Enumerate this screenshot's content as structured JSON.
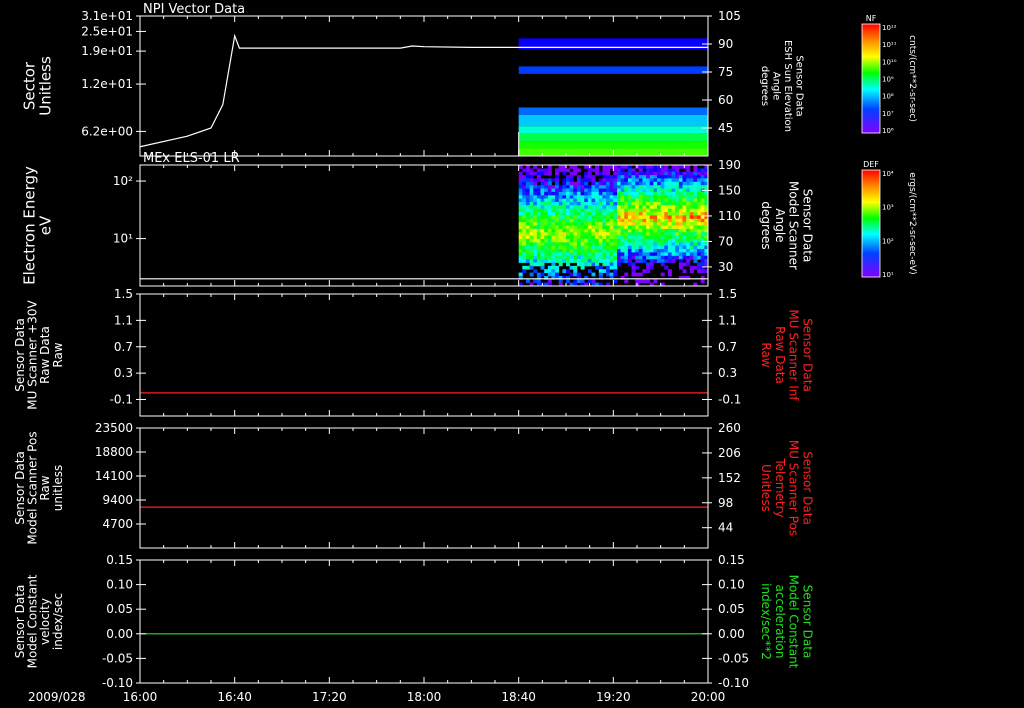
{
  "date_label": "2009/028",
  "time_ticks": [
    "16:00",
    "16:40",
    "17:20",
    "18:00",
    "18:40",
    "19:20",
    "20:00"
  ],
  "colors": {
    "axis": "#ffffff",
    "red": "#ff2020",
    "green": "#20e020"
  },
  "chart_data": [
    {
      "type": "line+spectrogram",
      "title": "NPI Vector Data",
      "left_axis": {
        "label": [
          "Sector",
          "Unitless"
        ],
        "log": true,
        "ylim": [
          4.4,
          31
        ],
        "ticks": [
          {
            "v": 31,
            "t": "3.1e+01"
          },
          {
            "v": 25,
            "t": "2.5e+01"
          },
          {
            "v": 19,
            "t": "1.9e+01"
          },
          {
            "v": 12,
            "t": "1.2e+01"
          },
          {
            "v": 6.2,
            "t": "6.2e+00"
          }
        ]
      },
      "right_axis": {
        "label": [
          "Sensor Data",
          "ESH Sun Elevation",
          "Angle",
          "degrees"
        ],
        "ylim": [
          30,
          105
        ],
        "ticks": [
          {
            "v": 105,
            "t": "105"
          },
          {
            "v": 90,
            "t": "90"
          },
          {
            "v": 75,
            "t": "75"
          },
          {
            "v": 60,
            "t": "60"
          },
          {
            "v": 45,
            "t": "45"
          }
        ]
      },
      "line": {
        "x": [
          "16:00",
          "16:20",
          "16:30",
          "16:35",
          "16:40",
          "16:42",
          "17:30",
          "17:50",
          "17:55",
          "18:00",
          "18:20",
          "18:40",
          "20:00"
        ],
        "y": [
          5.0,
          5.8,
          6.5,
          9.0,
          23.5,
          19.8,
          19.8,
          19.8,
          20.4,
          20.2,
          20.0,
          20.0,
          20.0
        ]
      },
      "spectrogram": {
        "x_start": "18:40",
        "x_end": "20:00",
        "bands": [
          {
            "y0": 87,
            "y1": 93,
            "level": 0.12
          },
          {
            "y0": 74,
            "y1": 78,
            "level": 0.18
          },
          {
            "y0": 52,
            "y1": 56,
            "level": 0.22
          },
          {
            "y0": 46,
            "y1": 52,
            "level": 0.3
          },
          {
            "y0": 42,
            "y1": 46,
            "level": 0.38
          },
          {
            "y0": 38,
            "y1": 42,
            "level": 0.5
          },
          {
            "y0": 34,
            "y1": 38,
            "level": 0.58
          },
          {
            "y0": 30,
            "y1": 34,
            "level": 0.62
          }
        ]
      },
      "colorbar": {
        "label": "NF",
        "unit": "cnts/(cm**2-sr-sec)",
        "ticks": [
          "10¹²",
          "10¹¹",
          "10¹⁰",
          "10⁹",
          "10⁸",
          "10⁷",
          "10⁶"
        ]
      }
    },
    {
      "type": "spectrogram",
      "title": "MEx ELS-01 LR",
      "left_axis": {
        "label": [
          "Electron Energy",
          "eV"
        ],
        "log": true,
        "ylim": [
          1.5,
          190
        ],
        "ticks": [
          {
            "v": 100,
            "t": "10²"
          },
          {
            "v": 10,
            "t": "10¹"
          }
        ]
      },
      "right_axis": {
        "label": [
          "Sensor Data",
          "Model Scanner",
          "Angle",
          "degrees"
        ],
        "ylim": [
          0,
          190
        ],
        "ticks": [
          {
            "v": 190,
            "t": "190"
          },
          {
            "v": 150,
            "t": "150"
          },
          {
            "v": 110,
            "t": "110"
          },
          {
            "v": 70,
            "t": "70"
          },
          {
            "v": 30,
            "t": "30"
          }
        ]
      },
      "line": {
        "x": [
          "16:00",
          "20:00"
        ],
        "y": [
          2.0,
          2.0
        ]
      },
      "spectrogram": {
        "x_start": "18:40",
        "x_end": "20:00",
        "change": "19:20"
      },
      "colorbar": {
        "label": "DEF",
        "unit": "ergs/(cm**2-sr-sec-eV)",
        "ticks": [
          "10⁴",
          "10³",
          "10²",
          "10¹"
        ]
      }
    },
    {
      "type": "line",
      "left_axis": {
        "label": [
          "Sensor Data",
          "MU Scanner +30V",
          "Raw Data",
          "Raw"
        ],
        "ylim": [
          -0.35,
          1.5
        ],
        "ticks": [
          {
            "v": 1.5,
            "t": "1.5"
          },
          {
            "v": 1.1,
            "t": "1.1"
          },
          {
            "v": 0.7,
            "t": "0.7"
          },
          {
            "v": 0.3,
            "t": "0.3"
          },
          {
            "v": -0.1,
            "t": "-0.1"
          }
        ]
      },
      "right_axis": {
        "label": [
          "Sensor Data",
          "MU Scanner Inf",
          "Raw Data",
          "Raw"
        ],
        "color": "red",
        "ylim": [
          -0.35,
          1.5
        ],
        "ticks": [
          {
            "v": 1.5,
            "t": "1.5"
          },
          {
            "v": 1.1,
            "t": "1.1"
          },
          {
            "v": 0.7,
            "t": "0.7"
          },
          {
            "v": 0.3,
            "t": "0.3"
          },
          {
            "v": -0.1,
            "t": "-0.1"
          }
        ]
      },
      "series": [
        {
          "color": "red",
          "x": [
            "16:00",
            "20:00"
          ],
          "y": [
            0.0,
            0.0
          ]
        }
      ]
    },
    {
      "type": "line",
      "left_axis": {
        "label": [
          "Sensor Data",
          "Model Scanner Pos",
          "Raw",
          "unitless"
        ],
        "ylim": [
          0,
          23500
        ],
        "ticks": [
          {
            "v": 23500,
            "t": "23500"
          },
          {
            "v": 18800,
            "t": "18800"
          },
          {
            "v": 14100,
            "t": "14100"
          },
          {
            "v": 9400,
            "t": "9400"
          },
          {
            "v": 4700,
            "t": "4700"
          }
        ]
      },
      "right_axis": {
        "label": [
          "Sensor Data",
          "MU Scanner Pos",
          "Telemetry",
          "Unitless"
        ],
        "color": "red",
        "ylim": [
          0,
          260
        ],
        "ticks": [
          {
            "v": 260,
            "t": "260"
          },
          {
            "v": 206,
            "t": "206"
          },
          {
            "v": 152,
            "t": "152"
          },
          {
            "v": 98,
            "t": "98"
          },
          {
            "v": 44,
            "t": "44"
          }
        ]
      },
      "series": [
        {
          "color": "red",
          "x": [
            "16:00",
            "20:00"
          ],
          "y": [
            8000,
            8000
          ]
        }
      ]
    },
    {
      "type": "line",
      "left_axis": {
        "label": [
          "Sensor Data",
          "Model Constant",
          "velocity",
          "index/sec"
        ],
        "ylim": [
          -0.1,
          0.15
        ],
        "ticks": [
          {
            "v": 0.15,
            "t": "0.15"
          },
          {
            "v": 0.1,
            "t": "0.10"
          },
          {
            "v": 0.05,
            "t": "0.05"
          },
          {
            "v": 0,
            "t": "0.00"
          },
          {
            "v": -0.05,
            "t": "-0.05"
          },
          {
            "v": -0.1,
            "t": "-0.10"
          }
        ]
      },
      "right_axis": {
        "label": [
          "Sensor Data",
          "Model Constant",
          "acceleration",
          "index/sec**2"
        ],
        "color": "green",
        "ylim": [
          -0.1,
          0.15
        ],
        "ticks": [
          {
            "v": 0.15,
            "t": "0.15"
          },
          {
            "v": 0.1,
            "t": "0.10"
          },
          {
            "v": 0.05,
            "t": "0.05"
          },
          {
            "v": 0,
            "t": "0.00"
          },
          {
            "v": -0.05,
            "t": "-0.05"
          },
          {
            "v": -0.1,
            "t": "-0.10"
          }
        ]
      },
      "series": [
        {
          "color": "green",
          "x": [
            "16:00",
            "20:00"
          ],
          "y": [
            0.0,
            0.0
          ]
        }
      ]
    }
  ]
}
